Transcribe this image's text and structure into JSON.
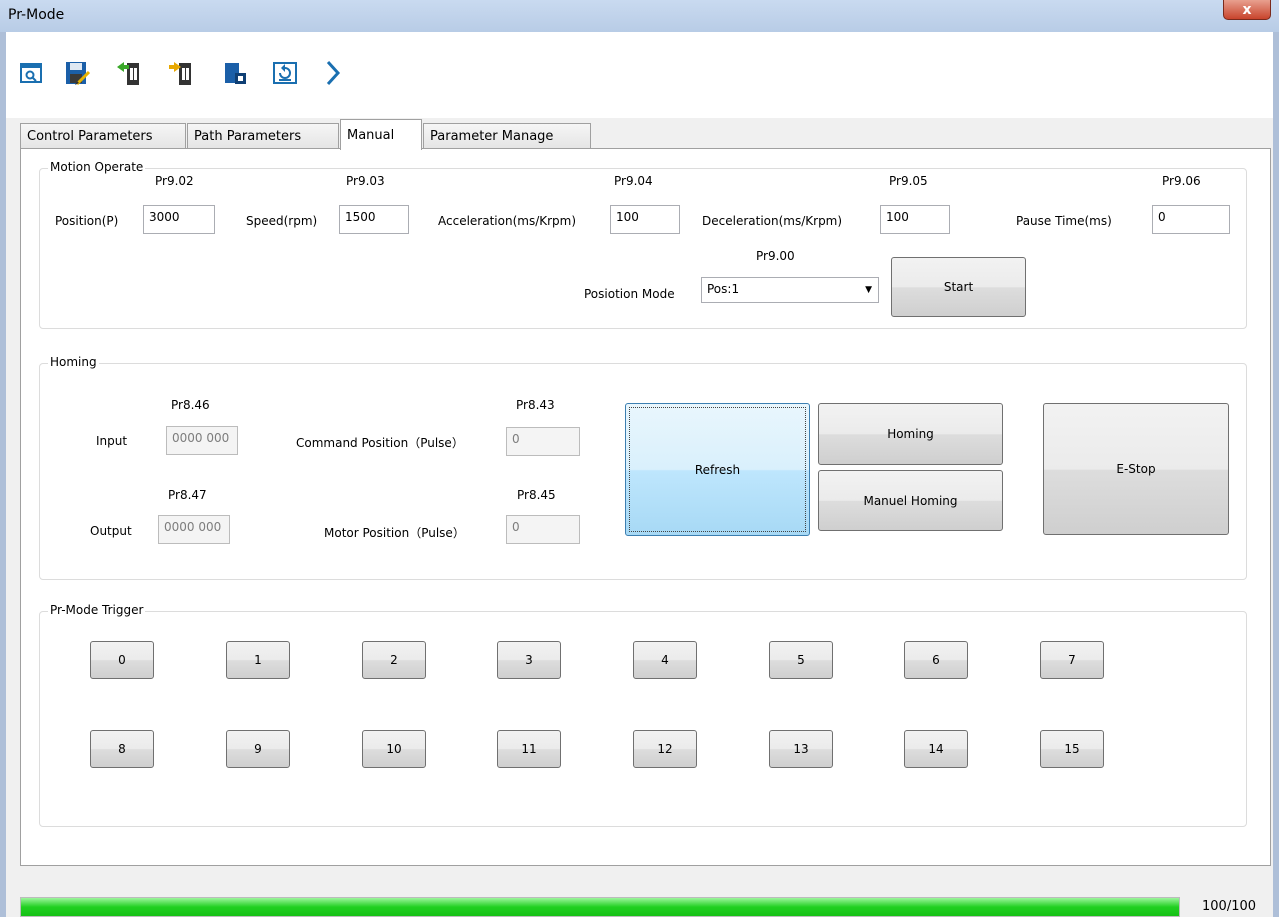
{
  "window": {
    "title": "Pr-Mode",
    "close_label": "x"
  },
  "toolbar": {
    "icons": [
      "open-file-icon",
      "save-icon",
      "read-from-drive-icon",
      "write-to-drive-icon",
      "save-to-eeprom-icon",
      "reset-icon",
      "next-icon"
    ]
  },
  "tabs": [
    "Control Parameters",
    "Path Parameters",
    "Manual",
    "Parameter Manage"
  ],
  "active_tab": "Manual",
  "motion": {
    "title": "Motion Operate",
    "position": {
      "pr": "Pr9.02",
      "label": "Position(P)",
      "value": "3000"
    },
    "speed": {
      "pr": "Pr9.03",
      "label": "Speed(rpm)",
      "value": "1500"
    },
    "accel": {
      "pr": "Pr9.04",
      "label": "Acceleration(ms/Krpm)",
      "value": "100"
    },
    "decel": {
      "pr": "Pr9.05",
      "label": "Deceleration(ms/Krpm)",
      "value": "100"
    },
    "pause": {
      "pr": "Pr9.06",
      "label": "Pause Time(ms)",
      "value": "0"
    },
    "mode": {
      "pr": "Pr9.00",
      "label": "Posiotion Mode",
      "value": "Pos:1"
    },
    "start_label": "Start"
  },
  "homing": {
    "title": "Homing",
    "input": {
      "pr": "Pr8.46",
      "label": "Input",
      "value": "0000 000"
    },
    "output": {
      "pr": "Pr8.47",
      "label": "Output",
      "value": "0000 000"
    },
    "cmd_pos": {
      "pr": "Pr8.43",
      "label": "Command Position（Pulse）",
      "value": "0"
    },
    "motor_pos": {
      "pr": "Pr8.45",
      "label": "Motor Position（Pulse）",
      "value": "0"
    },
    "refresh_label": "Refresh",
    "homing_label": "Homing",
    "manuel_label": "Manuel Homing",
    "estop_label": "E-Stop"
  },
  "trigger": {
    "title": "Pr-Mode Trigger",
    "buttons": [
      "0",
      "1",
      "2",
      "3",
      "4",
      "5",
      "6",
      "7",
      "8",
      "9",
      "10",
      "11",
      "12",
      "13",
      "14",
      "15"
    ]
  },
  "progress": {
    "value": 1.0,
    "text": "100/100",
    "color": "#21d021"
  },
  "colors": {
    "accent": "#3c7fb1",
    "progress": "#21d021"
  }
}
